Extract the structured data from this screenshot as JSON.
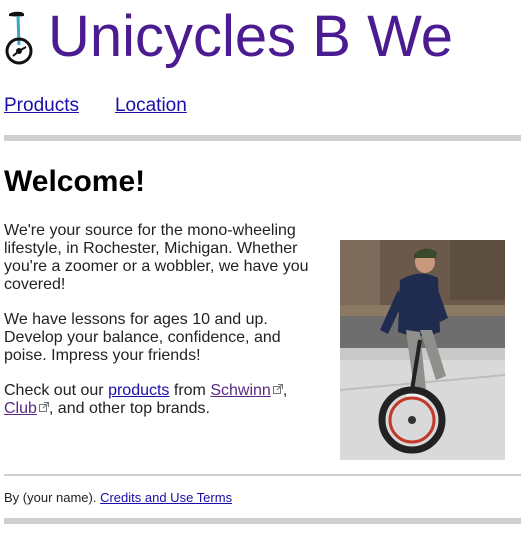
{
  "header": {
    "site_title": "Unicycles B We",
    "logo_icon": "unicycle-icon"
  },
  "nav": {
    "products_label": "Products",
    "location_label": "Location"
  },
  "main": {
    "heading": "Welcome!",
    "p1": "We're your source for the mono-wheeling lifestyle, in Rochester, Michigan. Whether you're a zoomer or a wobbler, we have you covered!",
    "p2": "We have lessons for ages 10 and up. Develop your balance, confidence, and poise. Impress your friends!",
    "p3_prefix": "Check out our ",
    "products_link": "products",
    "p3_from": " from ",
    "schwinn_link": "Schwinn",
    "p3_comma": ",",
    "club_link": "Club",
    "p3_suffix": ", and other top brands.",
    "external_icon": "external-link-icon",
    "photo_icon": "unicycle-rider-photo"
  },
  "footer": {
    "byline": "By (your name). ",
    "credits_link": "Credits and Use Terms"
  },
  "colors": {
    "title": "#4b1c91",
    "link": "#1a0dab",
    "visited_link": "#5a2a82",
    "rule": "#cfcfcf"
  }
}
